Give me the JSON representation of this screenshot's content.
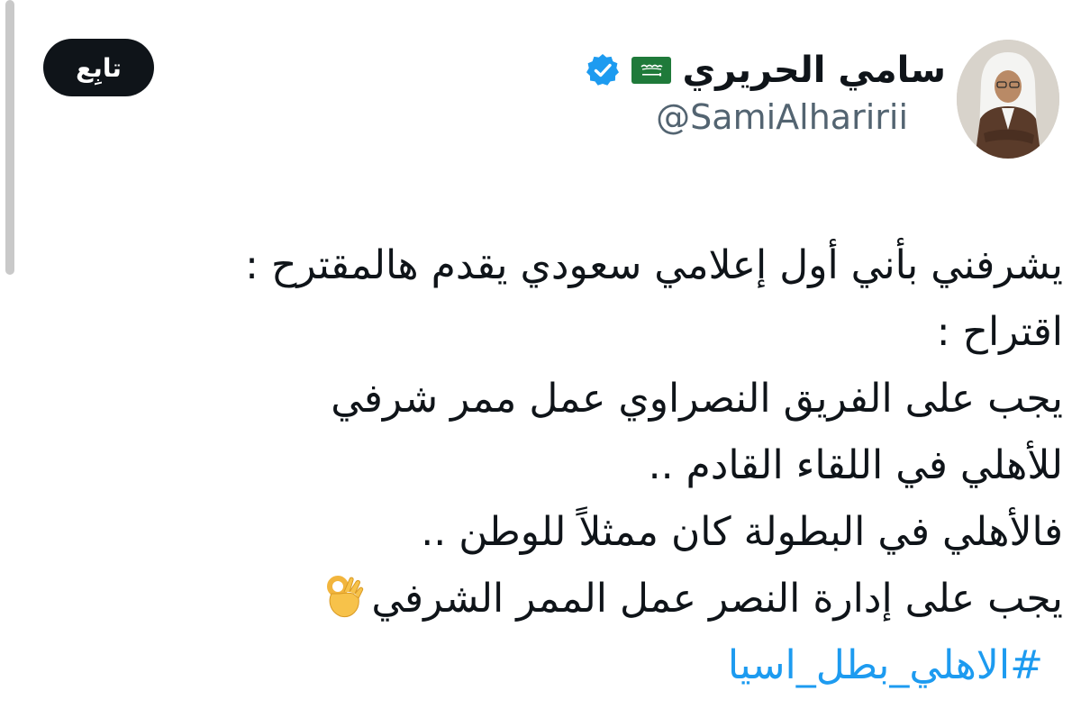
{
  "follow_button": {
    "label": "تابِع"
  },
  "author": {
    "display_name": "سامي الحريري",
    "handle": "@SamiAlharirii",
    "flag_icon": "saudi-flag-icon",
    "verified_icon": "verified-badge-icon",
    "verified_color": "#1d9bf0"
  },
  "tweet": {
    "lines": [
      "يشرفني بأني أول إعلامي سعودي يقدم هالمقترح :",
      "اقتراح :",
      "يجب على الفريق النصراوي عمل ممر شرفي",
      "للأهلي في اللقاء القادم ..",
      "فالأهلي في البطولة كان ممثلاً للوطن ..",
      "يجب على إدارة النصر عمل الممر الشرفي"
    ],
    "trailing_emoji": "ok-hand-icon",
    "hashtag": "#الاهلي_بطل_اسيا"
  },
  "colors": {
    "text": "#0f1419",
    "secondary_text": "#536471",
    "link": "#1d9bf0",
    "button_bg": "#0f1419",
    "flag_green": "#1f7a3a"
  }
}
